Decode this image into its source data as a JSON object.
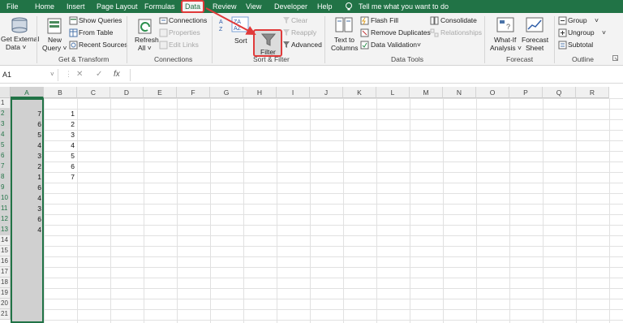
{
  "menu": {
    "items": [
      "File",
      "Home",
      "Insert",
      "Page Layout",
      "Formulas",
      "Data",
      "Review",
      "View",
      "Developer",
      "Help"
    ],
    "tell_me": "Tell me what you want to do"
  },
  "ribbon": {
    "get_external_data": [
      "Get External",
      "Data ˅"
    ],
    "new_query": [
      "New",
      "Query ˅"
    ],
    "show_queries": "Show Queries",
    "from_table": "From Table",
    "recent_sources": "Recent Sources",
    "get_transform_label": "Get & Transform",
    "refresh_all": [
      "Refresh",
      "All ˅"
    ],
    "connections": "Connections",
    "properties": "Properties",
    "edit_links": "Edit Links",
    "connections_label": "Connections",
    "sort": "Sort",
    "filter": "Filter",
    "clear": "Clear",
    "reapply": "Reapply",
    "advanced": "Advanced",
    "sort_filter_label": "Sort & Filter",
    "text_to_columns": [
      "Text to",
      "Columns"
    ],
    "flash_fill": "Flash Fill",
    "remove_duplicates": "Remove Duplicates",
    "data_validation": "Data Validation",
    "consolidate": "Consolidate",
    "relationships": "Relationships",
    "data_tools_label": "Data Tools",
    "what_if": [
      "What-If",
      "Analysis ˅"
    ],
    "forecast_sheet": [
      "Forecast",
      "Sheet"
    ],
    "forecast_label": "Forecast",
    "group": "Group",
    "ungroup": "Ungroup",
    "subtotal": "Subtotal",
    "outline_label": "Outline"
  },
  "formula_bar": {
    "name_box": "A1",
    "cancel": "✕",
    "enter": "✓",
    "fx": "fx",
    "value": ""
  },
  "sheet": {
    "columns": [
      "A",
      "B",
      "C",
      "D",
      "E",
      "F",
      "G",
      "H",
      "I",
      "J",
      "K",
      "L",
      "M",
      "N",
      "O",
      "P",
      "Q",
      "R"
    ],
    "rows": [
      "1",
      "2",
      "3",
      "4",
      "5",
      "6",
      "7",
      "8",
      "9",
      "10",
      "11",
      "12",
      "13",
      "14",
      "15",
      "16",
      "17",
      "18",
      "19",
      "20",
      "21"
    ],
    "col_a_values": [
      "",
      "7",
      "6",
      "5",
      "4",
      "3",
      "2",
      "1",
      "6",
      "4",
      "3",
      "6",
      "4"
    ],
    "col_b_values": [
      "",
      "1",
      "2",
      "3",
      "4",
      "5",
      "6",
      "7"
    ]
  },
  "colors": {
    "accent": "#217346",
    "highlight": "#e03a3a"
  }
}
